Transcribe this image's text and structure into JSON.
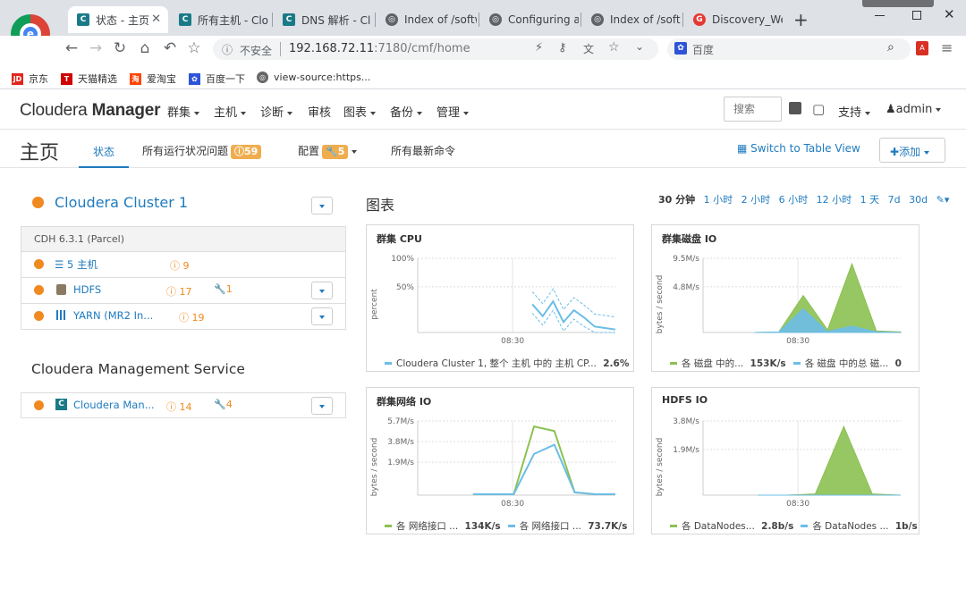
{
  "browser": {
    "tabs": [
      {
        "label": "状态 - 主页",
        "favicon": "C"
      },
      {
        "label": "所有主机 - Clo",
        "favicon": "C"
      },
      {
        "label": "DNS 解析 - Cl",
        "favicon": "C"
      },
      {
        "label": "Index of /softw",
        "favicon": "globe"
      },
      {
        "label": "Configuring a",
        "favicon": "globe"
      },
      {
        "label": "Index of /softw",
        "favicon": "globe"
      },
      {
        "label": "Discovery_We",
        "favicon": "G"
      }
    ],
    "insecure_label": "不安全",
    "url_host": "192.168.72.11",
    "url_rest": ":7180/cmf/home",
    "search_engine": "百度",
    "bookmarks": [
      "京东",
      "天猫精选",
      "爱淘宝",
      "百度一下",
      "view-source:https..."
    ]
  },
  "app": {
    "brand_light": "Cloudera",
    "brand_bold": "Manager",
    "menu": [
      "群集",
      "主机",
      "诊断",
      "审核",
      "图表",
      "备份",
      "管理"
    ],
    "search_placeholder": "搜索",
    "support": "支持",
    "user": "admin"
  },
  "page": {
    "title": "主页",
    "tabs": [
      {
        "label": "状态"
      },
      {
        "label": "所有运行状况问题",
        "badge": "59"
      },
      {
        "label": "配置",
        "badge": "5"
      },
      {
        "label": "所有最新命令"
      }
    ],
    "switch_view": "Switch to Table View",
    "add_button": "添加"
  },
  "cluster": {
    "name": "Cloudera Cluster 1",
    "version": "CDH 6.3.1 (Parcel)",
    "rows": [
      {
        "label": "5 主机",
        "issues": "9",
        "config": ""
      },
      {
        "label": "HDFS",
        "issues": "17",
        "config": "1"
      },
      {
        "label": "YARN (MR2 In...",
        "issues": "19",
        "config": ""
      }
    ]
  },
  "mgmt": {
    "title": "Cloudera Management Service",
    "row": {
      "label": "Cloudera Man...",
      "issues": "14",
      "config": "4"
    }
  },
  "charts_header": {
    "title": "图表",
    "ranges": [
      "30 分钟",
      "1 小时",
      "2 小时",
      "6 小时",
      "12 小时",
      "1 天",
      "7d",
      "30d"
    ],
    "selected": "30 分钟"
  },
  "colors": {
    "accent": "#1f7bbf",
    "warning": "#f0891f",
    "green": "#8cc152",
    "blue": "#6cbde6"
  },
  "chart_data": [
    {
      "type": "line",
      "title": "群集 CPU",
      "ylabel": "percent",
      "yticks": [
        "100%",
        "50%"
      ],
      "xtick": "08:30",
      "ylim": [
        0,
        100
      ],
      "x": [
        "08:30",
        "08:31",
        "08:32",
        "08:33",
        "08:34",
        "08:35",
        "08:36",
        "08:37",
        "08:38"
      ],
      "series": [
        {
          "name": "Cloudera Cluster 1, 整个 主机 中的 主机 CP...",
          "value_label": "2.6%",
          "values": [
            38,
            22,
            42,
            14,
            30,
            20,
            8,
            6,
            4
          ]
        }
      ]
    },
    {
      "type": "area",
      "title": "群集磁盘 IO",
      "ylabel": "bytes / second",
      "yticks": [
        "9.5M/s",
        "4.8M/s"
      ],
      "xtick": "08:30",
      "series": [
        {
          "name": "各 磁盘 中的...",
          "value_label": "153K/s",
          "values": [
            0,
            0.1,
            7,
            0.5,
            13,
            0.3,
            0.1
          ]
        },
        {
          "name": "各 磁盘 中的总 磁...",
          "value_label": "0",
          "values": [
            0,
            0.1,
            4.5,
            0.2,
            1.2,
            0.1,
            0
          ]
        }
      ]
    },
    {
      "type": "line",
      "title": "群集网络 IO",
      "ylabel": "bytes / second",
      "yticks": [
        "5.7M/s",
        "3.8M/s",
        "1.9M/s"
      ],
      "xtick": "08:30",
      "series": [
        {
          "name": "各 网络接口 ...",
          "value_label": "134K/s",
          "values": [
            0.1,
            0.1,
            0.1,
            7.5,
            7,
            0.3,
            0.1,
            0.1
          ]
        },
        {
          "name": "各 网络接口 ...",
          "value_label": "73.7K/s",
          "values": [
            0.1,
            0.1,
            0.1,
            4.5,
            5.5,
            0.3,
            0.1,
            0.1
          ]
        }
      ]
    },
    {
      "type": "area",
      "title": "HDFS IO",
      "ylabel": "bytes / second",
      "yticks": [
        "3.8M/s",
        "1.9M/s"
      ],
      "xtick": "08:30",
      "series": [
        {
          "name": "各 DataNodes...",
          "value_label": "2.8b/s",
          "values": [
            0,
            0,
            0.1,
            5.5,
            0.1,
            0
          ]
        },
        {
          "name": "各 DataNodes ...",
          "value_label": "1b/s",
          "values": [
            0,
            0,
            0,
            0,
            0,
            0
          ]
        }
      ]
    }
  ]
}
